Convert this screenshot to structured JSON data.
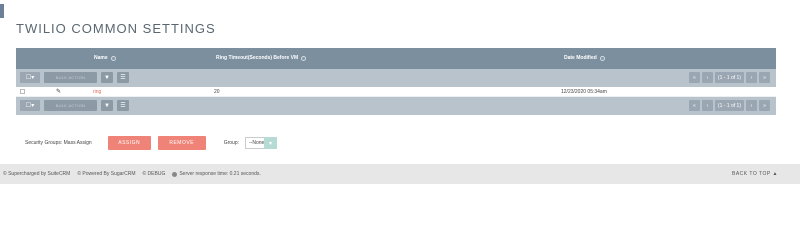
{
  "page": {
    "title": "TWILIO COMMON SETTINGS"
  },
  "list": {
    "columns": {
      "name": "Name",
      "ring_timeout": "Ring Timeout(Seconds) Before VM",
      "date_modified": "Date Modified"
    },
    "action_bar": {
      "bulk_action": "BULK ACTION",
      "pagination": "(1 - 1 of 1)"
    },
    "rows": [
      {
        "name": "ring",
        "ring_timeout": "20",
        "date_modified": "12/23/2020 05:34am"
      }
    ]
  },
  "mass_assign": {
    "label": "Security Groups: Mass Assign",
    "assign": "ASSIGN",
    "remove": "REMOVE",
    "group_label": "Group:",
    "group_value": "--None"
  },
  "footer": {
    "supercharged": "© Supercharged by SuiteCRM",
    "powered": "© Powered By SugarCRM",
    "debug": "© DEBUG",
    "server": "Server response time: 0.21 seconds.",
    "back_to_top": "BACK TO TOP ▲"
  },
  "colors": {
    "header": "#7b8f9f",
    "action_bar": "#b8c3cc",
    "accent_button": "#f08377",
    "link": "#e06b5e"
  }
}
